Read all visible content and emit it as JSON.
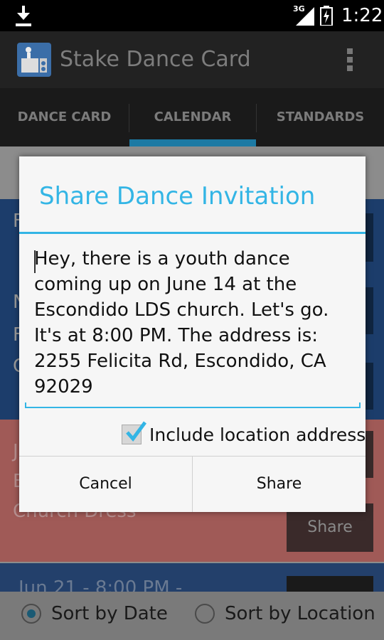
{
  "status_bar": {
    "network": "3G",
    "time": "1:22",
    "icons": [
      "download-icon",
      "signal-icon",
      "battery-icon"
    ]
  },
  "action_bar": {
    "title": "Stake Dance Card",
    "icon": "app-logo-icon",
    "overflow_icon": "overflow-menu-icon"
  },
  "tabs": [
    {
      "label": "DANCE CARD",
      "selected": false
    },
    {
      "label": "CALENDAR",
      "selected": true
    },
    {
      "label": "STANDARDS",
      "selected": false
    }
  ],
  "background": {
    "row1_partial": "F",
    "row2_partial": [
      "N",
      "F",
      "C"
    ],
    "row3_partial": [
      "J",
      "E",
      "Church Dress"
    ],
    "row3_share": "Share",
    "row4_partial": "Jun 21 - 8:00 PM -",
    "sort": {
      "by_date": "Sort by Date",
      "by_location": "Sort by Location",
      "selected": "by_date"
    }
  },
  "dialog": {
    "title": "Share Dance Invitation",
    "message_lines": [
      "Hey, there is a youth dance",
      "coming up on June 14 at the",
      "Escondido LDS church. Let's go.",
      "It's at 8:00 PM. The address is:",
      "2255 Felicita Rd, Escondido, CA",
      "92029"
    ],
    "include_address_label": "Include location address",
    "include_address_checked": true,
    "cancel_label": "Cancel",
    "share_label": "Share"
  },
  "colors": {
    "accent": "#33b5e5",
    "tab_indicator": "#1d7aa4"
  }
}
